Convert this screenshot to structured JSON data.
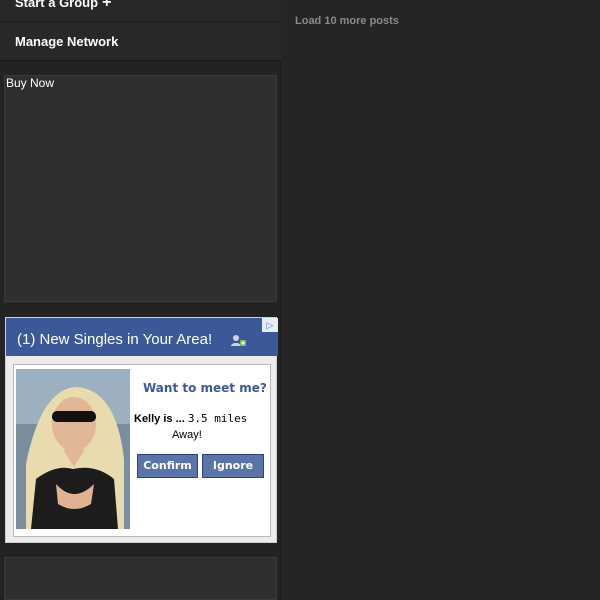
{
  "sidebar": {
    "start_group_label": "Start a Group",
    "manage_network_label": "Manage Network",
    "buy_now_label": "Buy Now"
  },
  "ad": {
    "header_title": "(1) New Singles in Your Area!",
    "adchoices_icon": "triangle-play-icon",
    "question": "Want to meet me?",
    "name_line": "Kelly is ...",
    "distance": "3.5 miles",
    "away": "Away!",
    "confirm_label": "Confirm",
    "ignore_label": "Ignore",
    "header_color": "#3b5998"
  },
  "main": {
    "load_more_label": "Load 10 more posts"
  }
}
